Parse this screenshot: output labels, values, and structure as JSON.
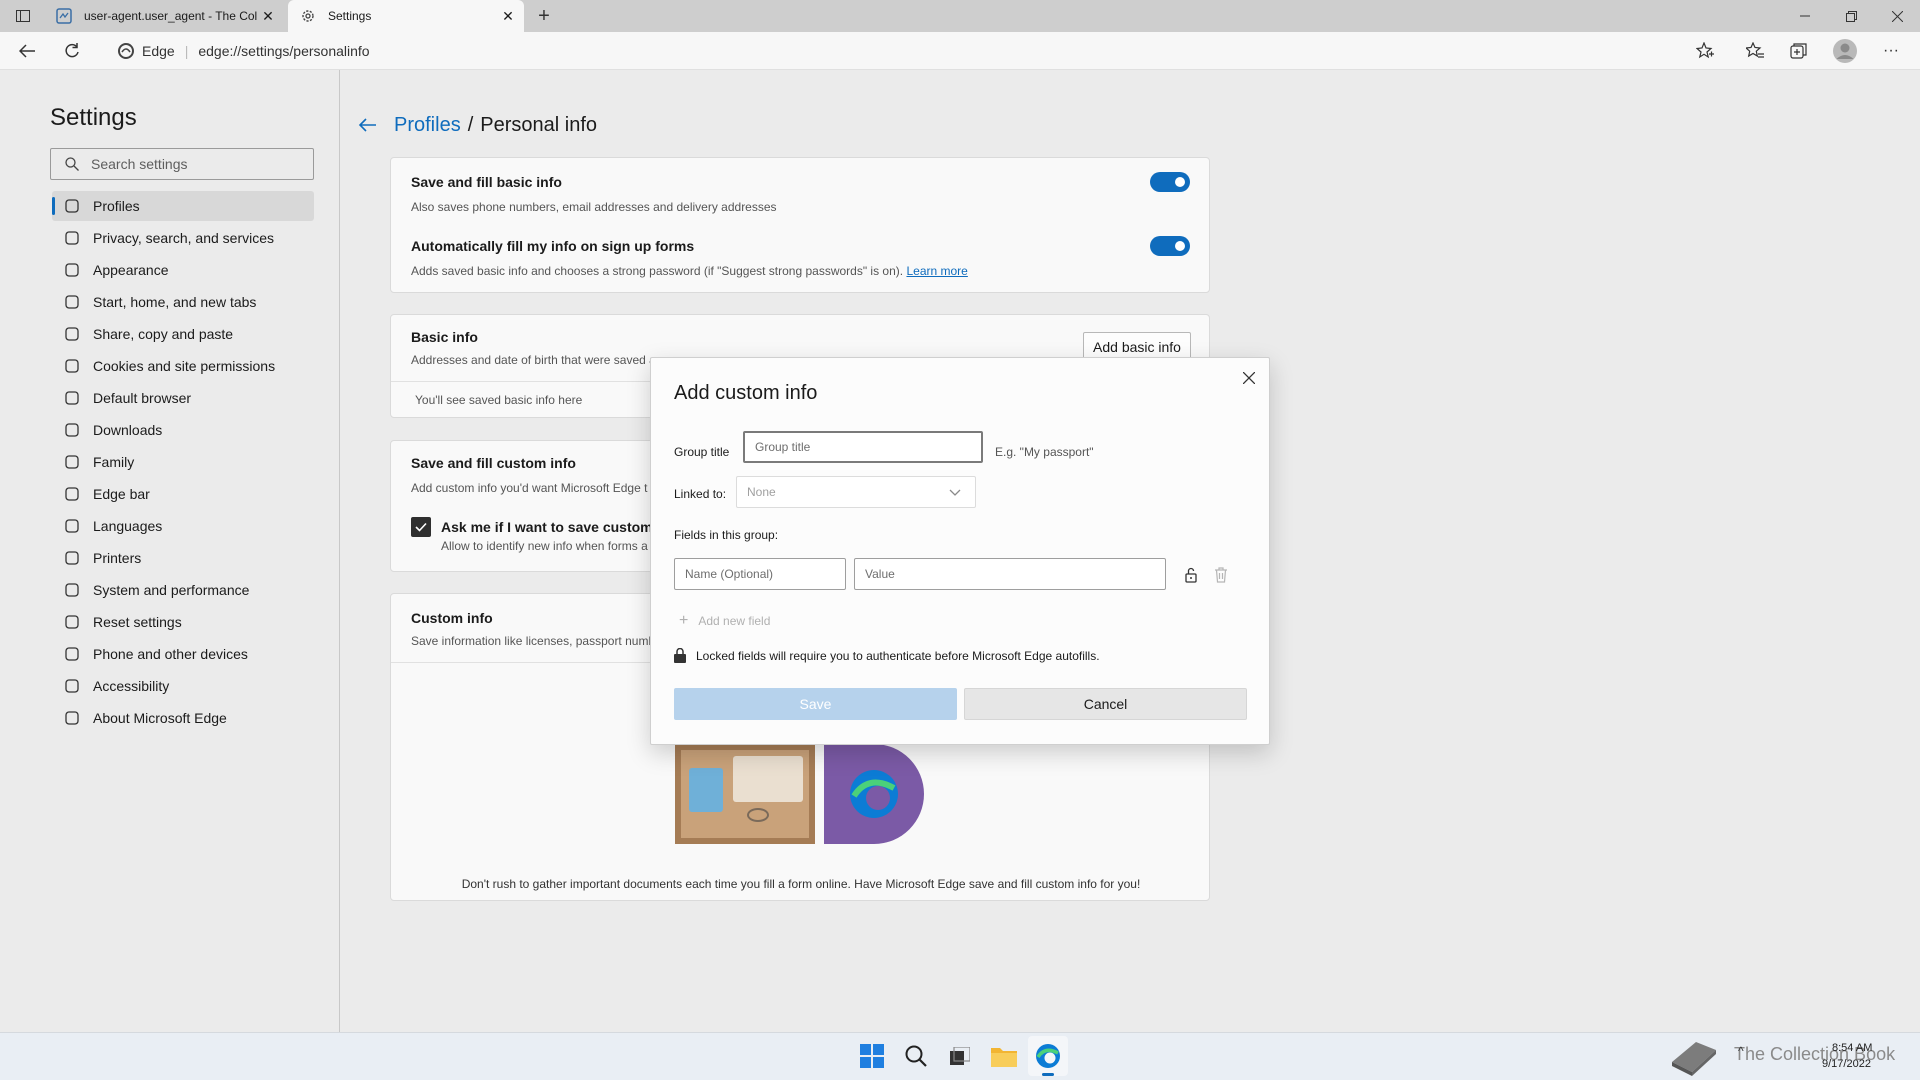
{
  "browser": {
    "tabs": [
      {
        "label": "user-agent.user_agent - The Coll"
      },
      {
        "label": "Settings"
      }
    ],
    "edge_label": "Edge",
    "url": "edge://settings/personalinfo"
  },
  "sidebar": {
    "title": "Settings",
    "search_placeholder": "Search settings",
    "items": [
      {
        "label": "Profiles",
        "icon": "profile-icon"
      },
      {
        "label": "Privacy, search, and services",
        "icon": "lock-icon"
      },
      {
        "label": "Appearance",
        "icon": "palette-icon"
      },
      {
        "label": "Start, home, and new tabs",
        "icon": "home-icon"
      },
      {
        "label": "Share, copy and paste",
        "icon": "share-icon"
      },
      {
        "label": "Cookies and site permissions",
        "icon": "cookie-icon"
      },
      {
        "label": "Default browser",
        "icon": "browser-icon"
      },
      {
        "label": "Downloads",
        "icon": "download-icon"
      },
      {
        "label": "Family",
        "icon": "family-icon"
      },
      {
        "label": "Edge bar",
        "icon": "edge-bar-icon"
      },
      {
        "label": "Languages",
        "icon": "language-icon"
      },
      {
        "label": "Printers",
        "icon": "printer-icon"
      },
      {
        "label": "System and performance",
        "icon": "system-icon"
      },
      {
        "label": "Reset settings",
        "icon": "reset-icon"
      },
      {
        "label": "Phone and other devices",
        "icon": "phone-icon"
      },
      {
        "label": "Accessibility",
        "icon": "accessibility-icon"
      },
      {
        "label": "About Microsoft Edge",
        "icon": "edge-logo-icon"
      }
    ]
  },
  "breadcrumb": {
    "parent": "Profiles",
    "separator": "/",
    "current": "Personal info"
  },
  "cards": {
    "save_fill_basic": {
      "title": "Save and fill basic info",
      "subtitle": "Also saves phone numbers, email addresses and delivery addresses"
    },
    "auto_fill": {
      "title": "Automatically fill my info on sign up forms",
      "subtitle": "Adds saved basic info and chooses a strong password (if \"Suggest strong passwords\" is on).",
      "learn_more": "Learn more"
    },
    "basic_info": {
      "title": "Basic info",
      "subtitle": "Addresses and date of birth that were saved a",
      "button": "Add basic info",
      "empty": "You'll see saved basic info here"
    },
    "save_fill_custom": {
      "title": "Save and fill custom info",
      "subtitle": "Add custom info you'd want Microsoft Edge t",
      "checkbox_label": "Ask me if I want to save custom i",
      "checkbox_sub": "Allow to identify new info when forms a"
    },
    "custom_info": {
      "title": "Custom info",
      "subtitle": "Save information like licenses, passport numb",
      "footer": "Don't rush to gather important documents each time you fill a form online. Have Microsoft Edge save and fill custom info for you!"
    }
  },
  "dialog": {
    "title": "Add custom info",
    "group_title_label": "Group title",
    "group_title_placeholder": "Group title",
    "group_title_hint": "E.g. \"My passport\"",
    "linked_to_label": "Linked to:",
    "linked_to_value": "None",
    "fields_label": "Fields in this group:",
    "name_placeholder": "Name (Optional)",
    "value_placeholder": "Value",
    "add_field": "Add new field",
    "lock_note": "Locked fields will require you to authenticate before Microsoft Edge autofills.",
    "save": "Save",
    "cancel": "Cancel"
  },
  "taskbar": {
    "time": "8:54 AM",
    "date": "9/17/2022",
    "watermark": "The Collection Book"
  },
  "colors": {
    "accent": "#0f6cbd",
    "save_disabled": "#b6d2ec"
  }
}
